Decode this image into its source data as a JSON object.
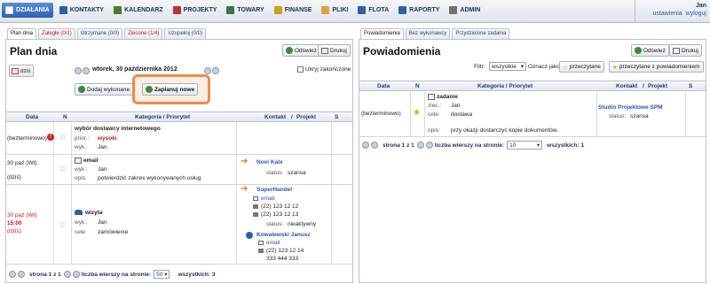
{
  "nav": {
    "items": [
      {
        "label": "DZIAŁANIA",
        "icon": "actions-icon",
        "color": "#ffffff"
      },
      {
        "label": "KONTAKTY",
        "icon": "contacts-icon",
        "color": "#2c5fae"
      },
      {
        "label": "KALENDARZ",
        "icon": "calendar-icon",
        "color": "#4a7a2a"
      },
      {
        "label": "PROJEKTY",
        "icon": "projects-icon",
        "color": "#c03030"
      },
      {
        "label": "TOWARY",
        "icon": "goods-icon",
        "color": "#2c7a4a"
      },
      {
        "label": "FINANSE",
        "icon": "finance-icon",
        "color": "#d0a020"
      },
      {
        "label": "PLIKI",
        "icon": "files-icon",
        "color": "#e0a040"
      },
      {
        "label": "FLOTA",
        "icon": "fleet-icon",
        "color": "#2c5fae"
      },
      {
        "label": "RAPORTY",
        "icon": "reports-icon",
        "color": "#3060a0"
      },
      {
        "label": "ADMIN",
        "icon": "admin-icon",
        "color": "#707070"
      }
    ]
  },
  "user": {
    "name": "Jan",
    "settings": "ustawienia",
    "logout": "wyloguj"
  },
  "left": {
    "tabs": [
      {
        "label": "Plan dnia",
        "style": "active"
      },
      {
        "label": "Zaległe (0/1)",
        "style": "red"
      },
      {
        "label": "Otrzymane (0/0)",
        "style": ""
      },
      {
        "label": "Zlecone (1/4)",
        "style": "red"
      },
      {
        "label": "Uzupełnij (0/0)",
        "style": ""
      }
    ],
    "title": "Plan dnia",
    "refresh": "Odśwież",
    "print": "Drukuj",
    "today": "dziś",
    "date": "wtorek, 30 października 2012",
    "hide_closed": "Ukryj zakończone",
    "add_done": "Dodaj wykonane",
    "plan_new": "Zaplanuj nowe",
    "headers": {
      "date": "Data",
      "n": "N",
      "category": "Kategoria / Priorytet",
      "contact": "Kontakt",
      "sep": "/",
      "project": "Projekt",
      "s": "S"
    },
    "rows": [
      {
        "date": "(bezterminowo)",
        "title": "wybór dostawcy internetowego",
        "prior_label": "prior.:",
        "prior_value": "wysoki",
        "wyk_label": "wyk.:",
        "wyk_value": "Jan"
      },
      {
        "date": "30 paź (Wt)",
        "date2": "(dziś)",
        "title": "email",
        "wyk_label": "wyk.:",
        "wyk_value": "Jan",
        "opis_label": "opis:",
        "opis_value": "potwierdzić zakres wykonywanych usług",
        "contact": "Novi Kalx",
        "status_label": "status:",
        "status_value": "szansa"
      },
      {
        "date": "30 paź (Wt)",
        "time": "15:00",
        "date2": "(dziś)",
        "title": "wizyta",
        "wyk_label": "wyk.:",
        "wyk_value": "Jan",
        "cele_label": "cele:",
        "cele_value": "zamówienie",
        "contact": "SuperHandel",
        "email": "email",
        "phone1": "(22) 123 12 12",
        "phone2": "(22) 123 12 13",
        "status_label": "status:",
        "status_value": "nieaktywny",
        "person": "Kowalewski Janusz",
        "email2": "email",
        "phone3": "(22) 123 12 14",
        "phone4": "333 444 333"
      }
    ],
    "pager": {
      "page": "strona 1 z 1",
      "rows_label": "liczba wierszy na stronie:",
      "rows_value": "50",
      "total": "wszystkich: 3"
    }
  },
  "right": {
    "tabs": [
      {
        "label": "Powiadomienia",
        "style": "active"
      },
      {
        "label": "Bez wykonawcy",
        "style": ""
      },
      {
        "label": "Przydzielone zadania",
        "style": ""
      }
    ],
    "title": "Powiadomienia",
    "refresh": "Odśwież",
    "print": "Drukuj",
    "filter_label": "Filtr:",
    "filter_value": "wszystkie",
    "mark_as": "Oznacz jako:",
    "mark_read": "przeczytane",
    "mark_read_notify": "przeczytane z powiadomieniem",
    "headers": {
      "date": "Data",
      "n": "N",
      "category": "Kategoria / Priorytet",
      "contact": "Kontakt",
      "sep": "/",
      "project": "Projekt",
      "s": "S"
    },
    "rows": [
      {
        "date": "(bezterminowo)",
        "title": "zadanie",
        "zlec_label": "zlec.:",
        "zlec_value": "Jan",
        "cele_label": "cele:",
        "cele_value": "dostawa",
        "opis_label": "opis:",
        "opis_value": "przy okazji dostarczyć kopie dokumentów.",
        "project": "Studio Projektowe SPM",
        "status_label": "status:",
        "status_value": "szansa"
      }
    ],
    "pager": {
      "page": "strona 1 z 1",
      "rows_label": "liczba wierszy na stronie:",
      "rows_value": "10",
      "total": "wszystkich: 1"
    }
  }
}
